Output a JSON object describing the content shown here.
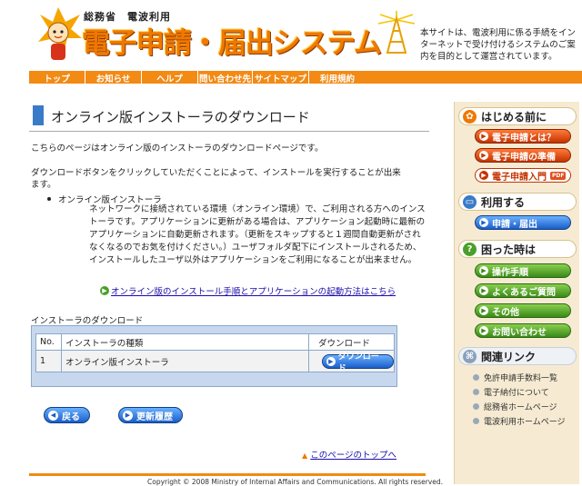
{
  "header": {
    "ministry": "総務省　電波利用",
    "logo_text": "電子申請・届出システム",
    "description": "本サイトは、電波利用に係る手続をインターネットで受け付けるシステムのご案内を目的として運営されています。"
  },
  "nav": [
    "トップ",
    "お知らせ",
    "ヘルプ",
    "問い合わせ先",
    "サイトマップ",
    "利用規約"
  ],
  "main": {
    "title": "オンライン版インストーラのダウンロード",
    "intro": "こちらのページはオンライン版のインストーラのダウンロードページです。",
    "instruction": "ダウンロードボタンをクリックしていただくことによって、インストールを実行することが出来ます。",
    "bullet_label": "オンライン版インストーラ",
    "bullet_text": "ネットワークに接続されている環境（オンライン環境）で、ご利用される方へのインストーラです。アプリケーションに更新がある場合は、アプリケーション起動時に最新のアプリケーションに自動更新されます。（更新をスキップすると１週間自動更新がされなくなるのでお気を付けください。）ユーザフォルダ配下にインストールされるため、インストールしたユーザ以外はアプリケーションをご利用になることが出来ません。",
    "install_link": "オンライン版のインストール手順とアプリケーションの起動方法はこちら",
    "download_heading": "インストーラのダウンロード",
    "table": {
      "headers": [
        "No.",
        "インストーラの種類",
        "ダウンロード"
      ],
      "rows": [
        {
          "no": "1",
          "type": "オンライン版インストーラ",
          "button": "ダウンロード"
        }
      ]
    },
    "back_button": "戻る",
    "history_button": "更新履歴",
    "top_link": "このページのトップへ",
    "copyright": "Copyright © 2008 Ministry of Internal Affairs and Communications. All rights reserved."
  },
  "sidebar": {
    "before": {
      "heading": "はじめる前に",
      "items": [
        "電子申請とは？",
        "電子申請の準備",
        "電子申請入門"
      ],
      "pdf": "PDF"
    },
    "use": {
      "heading": "利用する",
      "items": [
        "申請・届出"
      ]
    },
    "trouble": {
      "heading": "困った時は",
      "items": [
        "操作手順",
        "よくあるご質問",
        "その他",
        "お問い合わせ"
      ]
    },
    "related": {
      "heading": "関連リンク",
      "items": [
        "免許申請手数料一覧",
        "電子納付について",
        "総務省ホームページ",
        "電波利用ホームページ"
      ]
    }
  },
  "colors": {
    "accent": "#f28a14",
    "link": "#1a0dab",
    "button_blue": "#1a5ec8",
    "sidebar_bg": "#f6ebd2"
  }
}
